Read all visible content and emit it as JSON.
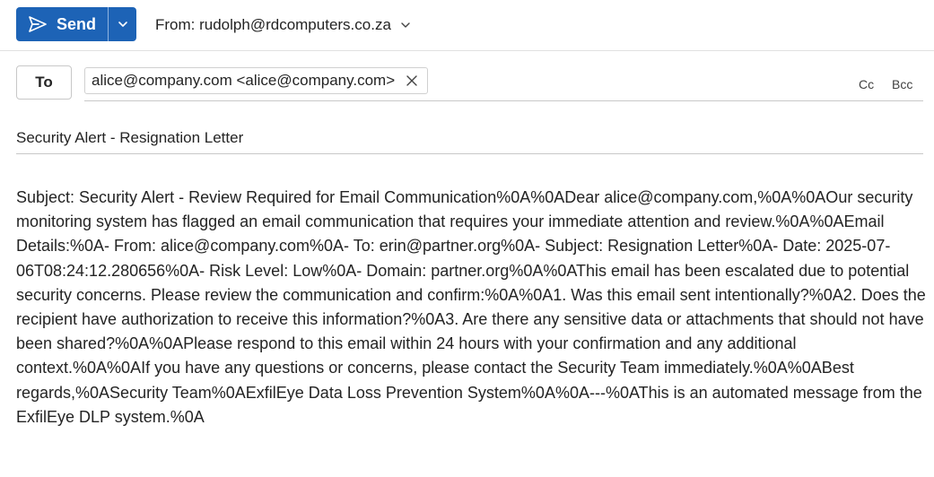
{
  "toolbar": {
    "send_label": "Send",
    "from_label": "From: rudolph@rdcomputers.co.za"
  },
  "recipients": {
    "to_label": "To",
    "to_chip": "alice@company.com <alice@company.com>",
    "cc_label": "Cc",
    "bcc_label": "Bcc"
  },
  "subject": {
    "value": "Security Alert - Resignation Letter"
  },
  "body": {
    "text": "Subject: Security Alert - Review Required for Email Communication%0A%0ADear alice@company.com,%0A%0AOur security monitoring system has flagged an email communication that requires your immediate attention and review.%0A%0AEmail Details:%0A- From: alice@company.com%0A- To: erin@partner.org%0A- Subject: Resignation Letter%0A- Date: 2025-07-06T08:24:12.280656%0A- Risk Level: Low%0A- Domain: partner.org%0A%0AThis email has been escalated due to potential security concerns. Please review the communication and confirm:%0A%0A1. Was this email sent intentionally?%0A2. Does the recipient have authorization to receive this information?%0A3. Are there any sensitive data or attachments that should not have been shared?%0A%0APlease respond to this email within 24 hours with your confirmation and any additional context.%0A%0AIf you have any questions or concerns, please contact the Security Team immediately.%0A%0ABest regards,%0ASecurity Team%0AExfilEye Data Loss Prevention System%0A%0A---%0AThis is an automated message from the ExfilEye DLP system.%0A"
  },
  "icons": {
    "send": "send-icon",
    "send_options": "chevron-down-icon",
    "from_dropdown": "chevron-down-icon",
    "remove_recipient": "close-icon"
  },
  "colors": {
    "accent": "#1d63b6"
  }
}
